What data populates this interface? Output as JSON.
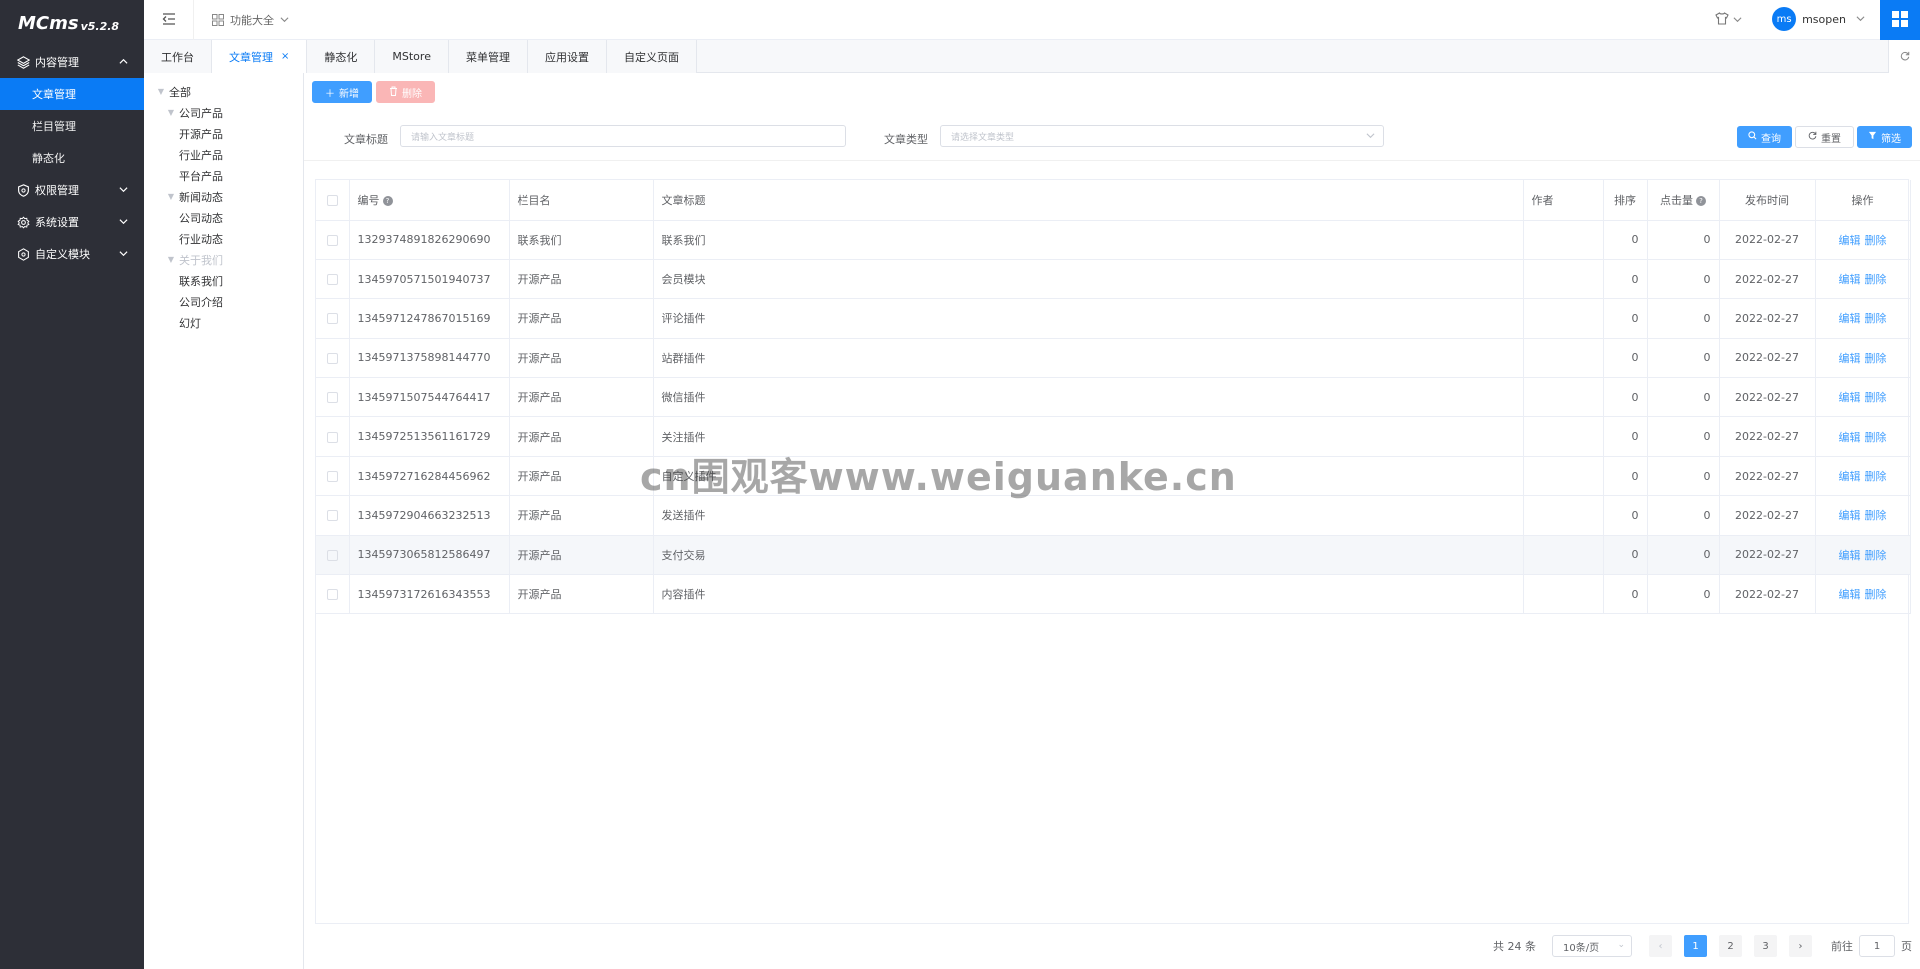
{
  "app": {
    "name": "MCms",
    "version": "v5.2.8"
  },
  "sidebar": {
    "groups": [
      {
        "label": "内容管理",
        "icon": "layers-icon",
        "expanded": true,
        "items": [
          {
            "label": "文章管理",
            "active": true
          },
          {
            "label": "栏目管理"
          },
          {
            "label": "静态化"
          }
        ]
      },
      {
        "label": "权限管理",
        "icon": "shield-icon",
        "expanded": false
      },
      {
        "label": "系统设置",
        "icon": "gear-icon",
        "expanded": false
      },
      {
        "label": "自定义模块",
        "icon": "hexagon-icon",
        "expanded": false
      }
    ]
  },
  "header": {
    "menu_label": "功能大全",
    "user": {
      "avatar_text": "ms",
      "name": "msopen"
    }
  },
  "tabs": [
    {
      "label": "工作台"
    },
    {
      "label": "文章管理",
      "active": true,
      "close": "×"
    },
    {
      "label": "静态化"
    },
    {
      "label": "MStore"
    },
    {
      "label": "菜单管理"
    },
    {
      "label": "应用设置"
    },
    {
      "label": "自定义页面"
    }
  ],
  "tree": [
    {
      "label": "全部",
      "level": 0,
      "caret": true
    },
    {
      "label": "公司产品",
      "level": 1,
      "caret": true
    },
    {
      "label": "开源产品",
      "level": 2
    },
    {
      "label": "行业产品",
      "level": 2
    },
    {
      "label": "平台产品",
      "level": 2
    },
    {
      "label": "新闻动态",
      "level": 1,
      "caret": true
    },
    {
      "label": "公司动态",
      "level": 2
    },
    {
      "label": "行业动态",
      "level": 2
    },
    {
      "label": "关于我们",
      "level": 1,
      "caret": true,
      "disabled": true
    },
    {
      "label": "联系我们",
      "level": 2
    },
    {
      "label": "公司介绍",
      "level": 2
    },
    {
      "label": "幻灯",
      "level": 1
    }
  ],
  "toolbar": {
    "add_label": "新增",
    "delete_label": "删除"
  },
  "search": {
    "title_label": "文章标题",
    "title_placeholder": "请输入文章标题",
    "type_label": "文章类型",
    "type_placeholder": "请选择文章类型",
    "query_label": "查询",
    "reset_label": "重置",
    "filter_label": "筛选"
  },
  "table": {
    "columns": [
      "编号",
      "栏目名",
      "文章标题",
      "作者",
      "排序",
      "点击量",
      "发布时间",
      "操作"
    ],
    "edit_label": "编辑",
    "delete_label": "删除",
    "rows": [
      {
        "id": "1329374891826290690",
        "category": "联系我们",
        "title": "联系我们",
        "author": "",
        "sort": "0",
        "hits": "0",
        "date": "2022-02-27"
      },
      {
        "id": "1345970571501940737",
        "category": "开源产品",
        "title": "会员模块",
        "author": "",
        "sort": "0",
        "hits": "0",
        "date": "2022-02-27"
      },
      {
        "id": "1345971247867015169",
        "category": "开源产品",
        "title": "评论插件",
        "author": "",
        "sort": "0",
        "hits": "0",
        "date": "2022-02-27"
      },
      {
        "id": "1345971375898144770",
        "category": "开源产品",
        "title": "站群插件",
        "author": "",
        "sort": "0",
        "hits": "0",
        "date": "2022-02-27"
      },
      {
        "id": "1345971507544764417",
        "category": "开源产品",
        "title": "微信插件",
        "author": "",
        "sort": "0",
        "hits": "0",
        "date": "2022-02-27"
      },
      {
        "id": "1345972513561161729",
        "category": "开源产品",
        "title": "关注插件",
        "author": "",
        "sort": "0",
        "hits": "0",
        "date": "2022-02-27"
      },
      {
        "id": "1345972716284456962",
        "category": "开源产品",
        "title": "自定义插件",
        "author": "",
        "sort": "0",
        "hits": "0",
        "date": "2022-02-27"
      },
      {
        "id": "1345972904663232513",
        "category": "开源产品",
        "title": "发送插件",
        "author": "",
        "sort": "0",
        "hits": "0",
        "date": "2022-02-27"
      },
      {
        "id": "1345973065812586497",
        "category": "开源产品",
        "title": "支付交易",
        "author": "",
        "sort": "0",
        "hits": "0",
        "date": "2022-02-27",
        "highlight": true
      },
      {
        "id": "1345973172616343553",
        "category": "开源产品",
        "title": "内容插件",
        "author": "",
        "sort": "0",
        "hits": "0",
        "date": "2022-02-27"
      }
    ]
  },
  "pagination": {
    "total_text": "共 24 条",
    "page_size": "10条/页",
    "pages": [
      "1",
      "2",
      "3"
    ],
    "current": "1",
    "goto_prefix": "前往",
    "goto_value": "1",
    "goto_suffix": "页"
  },
  "watermark": "cn围观客www.weiguanke.cn",
  "colors": {
    "accent": "#0a7bf5",
    "sidebar_bg": "#2d2f37",
    "primary_btn": "#409eff"
  }
}
